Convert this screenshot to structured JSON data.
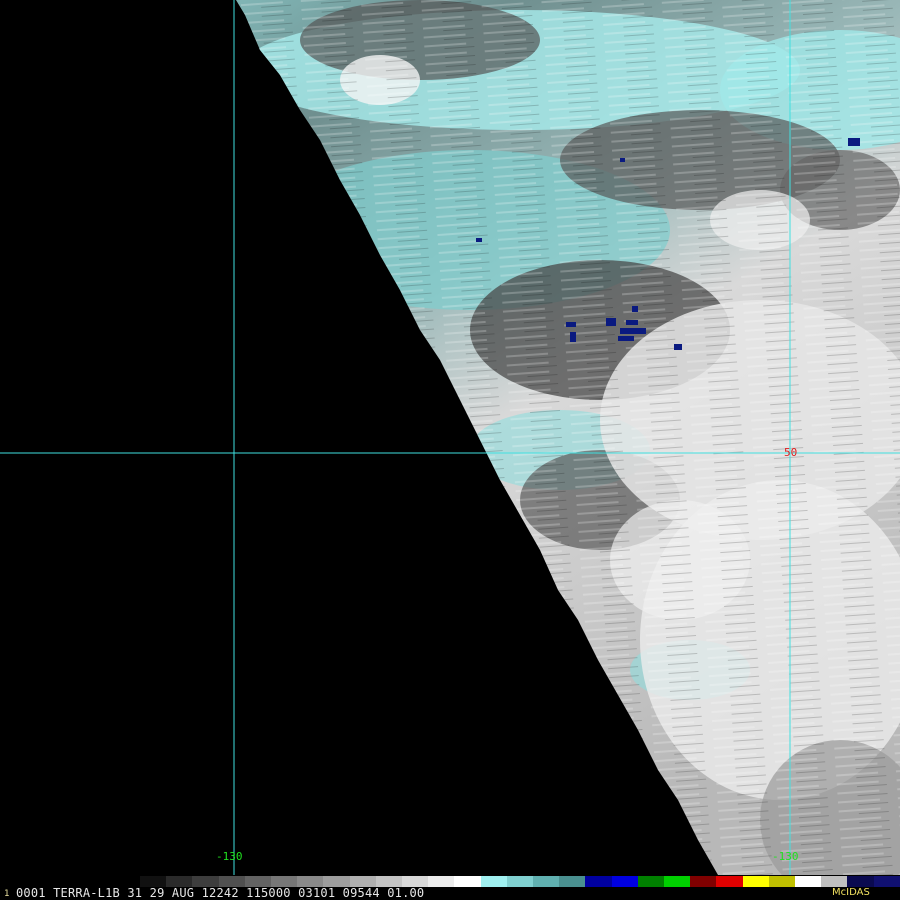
{
  "image": {
    "satellite": "TERRA-L1B",
    "frame_number": "1",
    "status_line": "0001 TERRA-L1B 31 29 AUG 12242 115000 03101 09544 01.00",
    "brand": "McIDAS"
  },
  "grid": {
    "longitude_label_left": "-130",
    "longitude_label_right": "-130",
    "latitude_label": "50",
    "line_color": "#40e0e0",
    "lon_label_color": "#20e020",
    "lat_label_color": "#e02020"
  },
  "colors": {
    "swath_cold": "#9ee8e8",
    "swath_mid": "#7a7a7a",
    "swath_warm": "#e8e8e8",
    "deep_convection": "#0a1a80",
    "background": "#000000"
  },
  "colorbar": [
    "#111111",
    "#2a2a2a",
    "#3d3d3d",
    "#505050",
    "#636363",
    "#777777",
    "#8a8a8a",
    "#9d9d9d",
    "#b0b0b0",
    "#c4c4c4",
    "#d8d8d8",
    "#ececec",
    "#ffffff",
    "#a0f0f0",
    "#80d0d0",
    "#60b0b0",
    "#4a9090",
    "#0000a0",
    "#0000e0",
    "#008000",
    "#00d000",
    "#800000",
    "#e00000",
    "#ffff00",
    "#c0c000",
    "#ffffff",
    "#c0c0c0",
    "#0a0a50",
    "#101070"
  ]
}
